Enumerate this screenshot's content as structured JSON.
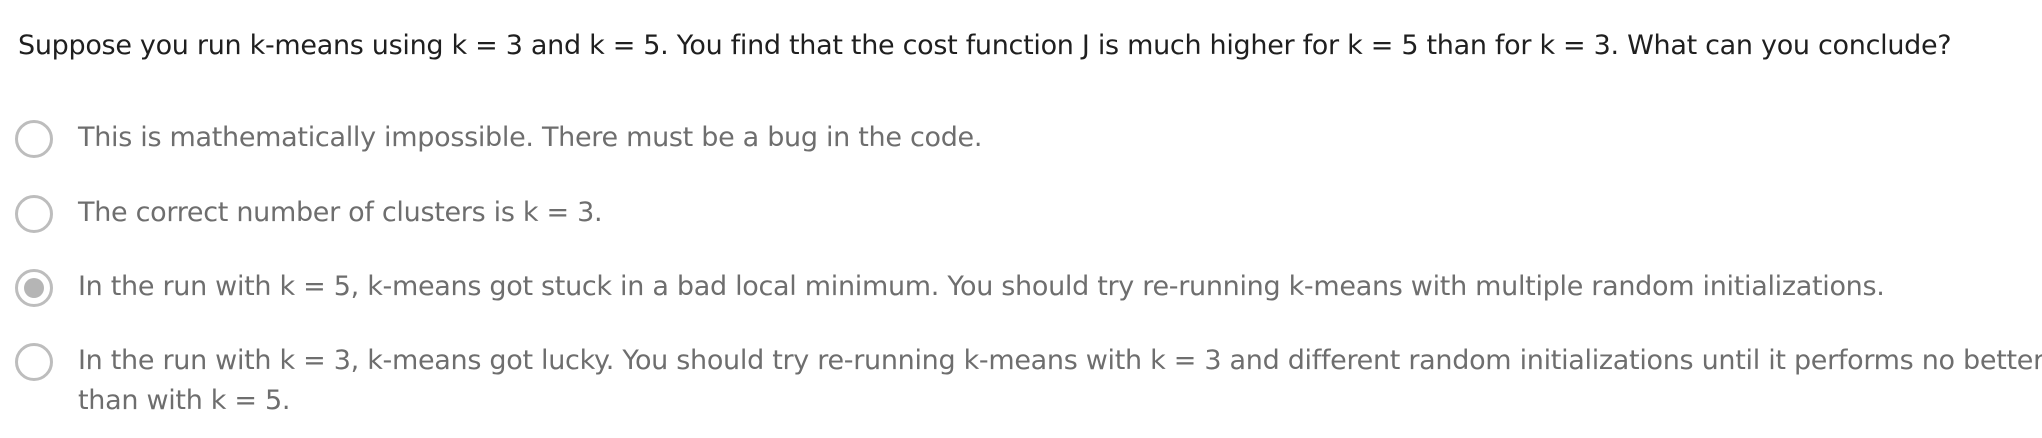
{
  "question": "Suppose you run k-means using k = 3 and k = 5. You find that the cost function J is much higher for k = 5 than for k = 3. What can you conclude?",
  "options": [
    {
      "line1": "This is mathematically impossible. There must be a bug in the code.",
      "line2": "",
      "selected": false
    },
    {
      "line1": "The correct number of clusters is k = 3.",
      "line2": "",
      "selected": false
    },
    {
      "line1": "In the run with k = 5, k-means got stuck in a bad local minimum. You should try re-running k-means with multiple random initializations.",
      "line2": "",
      "selected": true
    },
    {
      "line1": "In the run with k = 3, k-means got lucky. You should try re-running k-means with k = 3 and different random initializations until it performs no better",
      "line2": "than with k = 5.",
      "selected": false
    }
  ]
}
